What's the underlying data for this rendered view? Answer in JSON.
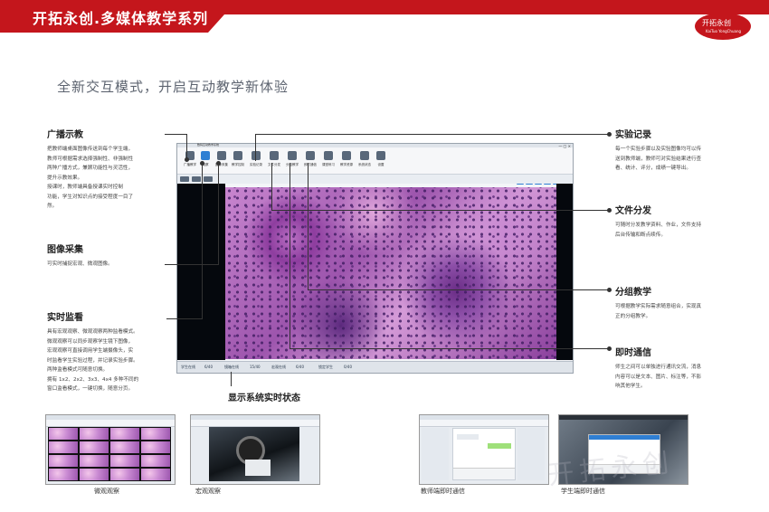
{
  "header": {
    "title": "开拓永创.多媒体教学系列",
    "logo_text": "开拓永创",
    "logo_subtext": "KaiTuo YongChuang"
  },
  "headline": "全新交互模式，开启互动教学新体验",
  "left_sections": [
    {
      "title": "广播示教",
      "body": [
        "把教师端桌面图像传送到每个学生端，",
        "教师可根据需求选择强制性、非强制性",
        "两种广播方式，兼顾功能性与灵活性，",
        "提升示教效果。",
        "授课时，教师端具备授课实时控制",
        "功能，学生对知识点的接受程度一目了",
        "然。"
      ]
    },
    {
      "title": "图像采集",
      "body": [
        "可实时捕捉宏观、微观图像。"
      ]
    },
    {
      "title": "实时监看",
      "body": [
        "具有宏观观察、微观观察两种监看模式。",
        "微观观察可以同步观察学生镜下图像，",
        "宏观观察可直接调用学生端摄像头，实",
        "时监看学生实验过程，并记录实验步骤。",
        "两种监看模式可随意切换。",
        "拥有 1x2、2x2、3x3、4x4 多种不同的",
        "窗口监看模式，一键切换，随意分页。"
      ]
    }
  ],
  "right_sections": [
    {
      "title": "实验记录",
      "body": [
        "每一个实验步骤以及实验图像均可以传",
        "送到教师端，教师可对实验结果进行查",
        "看、统计、评分，成绩一键导出。"
      ]
    },
    {
      "title": "文件分发",
      "body": [
        "可随时分发教学资料、作业，文件支持",
        "后台传输和断点续传。"
      ]
    },
    {
      "title": "分组教学",
      "body": [
        "可根据教学实际需求随意组合，实现真",
        "正的分组教学。"
      ]
    },
    {
      "title": "即时通信",
      "body": [
        "师生之间可以单独进行通讯交流，消息",
        "内容可以是文本、图片、标注等，不影",
        "响其他学生。"
      ]
    }
  ],
  "screenshot": {
    "window_title": "数码互动教学系统",
    "window_controls": "— □ ×",
    "toolbar": [
      {
        "label": "广播教学",
        "icon": "broadcast-icon",
        "active": false
      },
      {
        "label": "观察",
        "icon": "microscope-icon",
        "active": true
      },
      {
        "label": "图像采集",
        "icon": "camera-icon",
        "active": false
      },
      {
        "label": "教学控制",
        "icon": "control-icon",
        "active": false
      },
      {
        "label": "实验记录",
        "icon": "record-icon",
        "active": false
      },
      {
        "label": "文件分发",
        "icon": "file-icon",
        "active": false
      },
      {
        "label": "分组教学",
        "icon": "group-icon",
        "active": false
      },
      {
        "label": "即时通信",
        "icon": "chat-icon",
        "active": false
      },
      {
        "label": "课堂练习",
        "icon": "exercise-icon",
        "active": false
      },
      {
        "label": "教学资源",
        "icon": "resource-icon",
        "active": false
      },
      {
        "label": "系统状态",
        "icon": "status-icon",
        "active": false
      },
      {
        "label": "设置",
        "icon": "settings-icon",
        "active": false
      }
    ],
    "status_bar": [
      {
        "label": "学生在线",
        "value": "6/40"
      },
      {
        "label": "镜箱在线",
        "value": "15/40"
      },
      {
        "label": "宏观在线",
        "value": "6/40"
      },
      {
        "label": "锁定学生",
        "value": "0/40"
      }
    ]
  },
  "status_caption": "显示系统实时状态",
  "thumbnails": [
    {
      "caption": "微观观察"
    },
    {
      "caption": "宏观观察"
    },
    {
      "caption": "教师端即时通信"
    },
    {
      "caption": "学生端即时通信"
    }
  ],
  "watermark": "开拓永创",
  "colors": {
    "brand_red": "#c4161c",
    "accent_blue": "#2f7fd3"
  }
}
